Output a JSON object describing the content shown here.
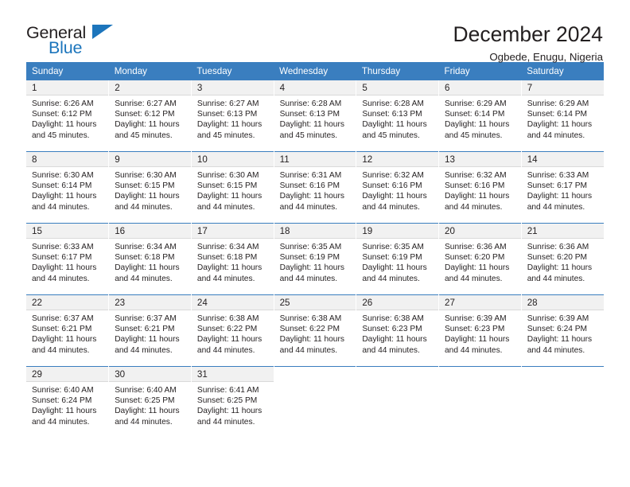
{
  "brand": {
    "name_part1": "General",
    "name_part2": "Blue",
    "logo_icon": "triangle-icon",
    "colors": {
      "accent": "#1c75bc",
      "text": "#231f20"
    }
  },
  "header": {
    "title": "December 2024",
    "subtitle": "Ogbede, Enugu, Nigeria"
  },
  "calendar": {
    "header_bg": "#3a7ebf",
    "daynum_bg": "#f1f1f1",
    "weekdays": [
      "Sunday",
      "Monday",
      "Tuesday",
      "Wednesday",
      "Thursday",
      "Friday",
      "Saturday"
    ],
    "labels": {
      "sunrise": "Sunrise:",
      "sunset": "Sunset:",
      "daylight": "Daylight:"
    },
    "weeks": [
      [
        {
          "day": "1",
          "sunrise": "Sunrise: 6:26 AM",
          "sunset": "Sunset: 6:12 PM",
          "daylight": "Daylight: 11 hours and 45 minutes."
        },
        {
          "day": "2",
          "sunrise": "Sunrise: 6:27 AM",
          "sunset": "Sunset: 6:12 PM",
          "daylight": "Daylight: 11 hours and 45 minutes."
        },
        {
          "day": "3",
          "sunrise": "Sunrise: 6:27 AM",
          "sunset": "Sunset: 6:13 PM",
          "daylight": "Daylight: 11 hours and 45 minutes."
        },
        {
          "day": "4",
          "sunrise": "Sunrise: 6:28 AM",
          "sunset": "Sunset: 6:13 PM",
          "daylight": "Daylight: 11 hours and 45 minutes."
        },
        {
          "day": "5",
          "sunrise": "Sunrise: 6:28 AM",
          "sunset": "Sunset: 6:13 PM",
          "daylight": "Daylight: 11 hours and 45 minutes."
        },
        {
          "day": "6",
          "sunrise": "Sunrise: 6:29 AM",
          "sunset": "Sunset: 6:14 PM",
          "daylight": "Daylight: 11 hours and 45 minutes."
        },
        {
          "day": "7",
          "sunrise": "Sunrise: 6:29 AM",
          "sunset": "Sunset: 6:14 PM",
          "daylight": "Daylight: 11 hours and 44 minutes."
        }
      ],
      [
        {
          "day": "8",
          "sunrise": "Sunrise: 6:30 AM",
          "sunset": "Sunset: 6:14 PM",
          "daylight": "Daylight: 11 hours and 44 minutes."
        },
        {
          "day": "9",
          "sunrise": "Sunrise: 6:30 AM",
          "sunset": "Sunset: 6:15 PM",
          "daylight": "Daylight: 11 hours and 44 minutes."
        },
        {
          "day": "10",
          "sunrise": "Sunrise: 6:30 AM",
          "sunset": "Sunset: 6:15 PM",
          "daylight": "Daylight: 11 hours and 44 minutes."
        },
        {
          "day": "11",
          "sunrise": "Sunrise: 6:31 AM",
          "sunset": "Sunset: 6:16 PM",
          "daylight": "Daylight: 11 hours and 44 minutes."
        },
        {
          "day": "12",
          "sunrise": "Sunrise: 6:32 AM",
          "sunset": "Sunset: 6:16 PM",
          "daylight": "Daylight: 11 hours and 44 minutes."
        },
        {
          "day": "13",
          "sunrise": "Sunrise: 6:32 AM",
          "sunset": "Sunset: 6:16 PM",
          "daylight": "Daylight: 11 hours and 44 minutes."
        },
        {
          "day": "14",
          "sunrise": "Sunrise: 6:33 AM",
          "sunset": "Sunset: 6:17 PM",
          "daylight": "Daylight: 11 hours and 44 minutes."
        }
      ],
      [
        {
          "day": "15",
          "sunrise": "Sunrise: 6:33 AM",
          "sunset": "Sunset: 6:17 PM",
          "daylight": "Daylight: 11 hours and 44 minutes."
        },
        {
          "day": "16",
          "sunrise": "Sunrise: 6:34 AM",
          "sunset": "Sunset: 6:18 PM",
          "daylight": "Daylight: 11 hours and 44 minutes."
        },
        {
          "day": "17",
          "sunrise": "Sunrise: 6:34 AM",
          "sunset": "Sunset: 6:18 PM",
          "daylight": "Daylight: 11 hours and 44 minutes."
        },
        {
          "day": "18",
          "sunrise": "Sunrise: 6:35 AM",
          "sunset": "Sunset: 6:19 PM",
          "daylight": "Daylight: 11 hours and 44 minutes."
        },
        {
          "day": "19",
          "sunrise": "Sunrise: 6:35 AM",
          "sunset": "Sunset: 6:19 PM",
          "daylight": "Daylight: 11 hours and 44 minutes."
        },
        {
          "day": "20",
          "sunrise": "Sunrise: 6:36 AM",
          "sunset": "Sunset: 6:20 PM",
          "daylight": "Daylight: 11 hours and 44 minutes."
        },
        {
          "day": "21",
          "sunrise": "Sunrise: 6:36 AM",
          "sunset": "Sunset: 6:20 PM",
          "daylight": "Daylight: 11 hours and 44 minutes."
        }
      ],
      [
        {
          "day": "22",
          "sunrise": "Sunrise: 6:37 AM",
          "sunset": "Sunset: 6:21 PM",
          "daylight": "Daylight: 11 hours and 44 minutes."
        },
        {
          "day": "23",
          "sunrise": "Sunrise: 6:37 AM",
          "sunset": "Sunset: 6:21 PM",
          "daylight": "Daylight: 11 hours and 44 minutes."
        },
        {
          "day": "24",
          "sunrise": "Sunrise: 6:38 AM",
          "sunset": "Sunset: 6:22 PM",
          "daylight": "Daylight: 11 hours and 44 minutes."
        },
        {
          "day": "25",
          "sunrise": "Sunrise: 6:38 AM",
          "sunset": "Sunset: 6:22 PM",
          "daylight": "Daylight: 11 hours and 44 minutes."
        },
        {
          "day": "26",
          "sunrise": "Sunrise: 6:38 AM",
          "sunset": "Sunset: 6:23 PM",
          "daylight": "Daylight: 11 hours and 44 minutes."
        },
        {
          "day": "27",
          "sunrise": "Sunrise: 6:39 AM",
          "sunset": "Sunset: 6:23 PM",
          "daylight": "Daylight: 11 hours and 44 minutes."
        },
        {
          "day": "28",
          "sunrise": "Sunrise: 6:39 AM",
          "sunset": "Sunset: 6:24 PM",
          "daylight": "Daylight: 11 hours and 44 minutes."
        }
      ],
      [
        {
          "day": "29",
          "sunrise": "Sunrise: 6:40 AM",
          "sunset": "Sunset: 6:24 PM",
          "daylight": "Daylight: 11 hours and 44 minutes."
        },
        {
          "day": "30",
          "sunrise": "Sunrise: 6:40 AM",
          "sunset": "Sunset: 6:25 PM",
          "daylight": "Daylight: 11 hours and 44 minutes."
        },
        {
          "day": "31",
          "sunrise": "Sunrise: 6:41 AM",
          "sunset": "Sunset: 6:25 PM",
          "daylight": "Daylight: 11 hours and 44 minutes."
        },
        {
          "day": "",
          "sunrise": "",
          "sunset": "",
          "daylight": ""
        },
        {
          "day": "",
          "sunrise": "",
          "sunset": "",
          "daylight": ""
        },
        {
          "day": "",
          "sunrise": "",
          "sunset": "",
          "daylight": ""
        },
        {
          "day": "",
          "sunrise": "",
          "sunset": "",
          "daylight": ""
        }
      ]
    ]
  }
}
